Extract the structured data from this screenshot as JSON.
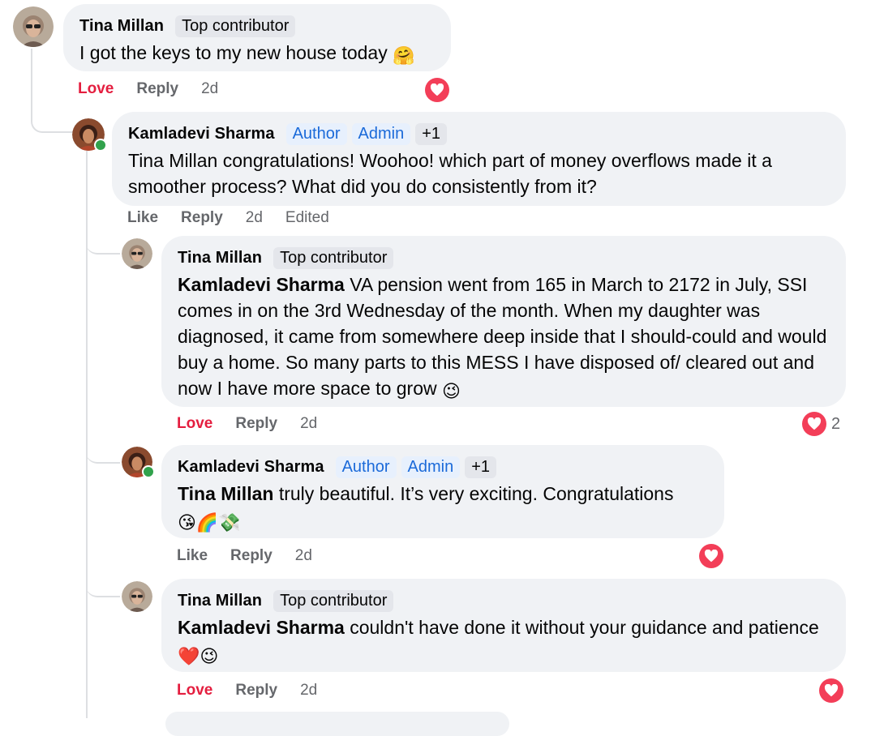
{
  "comments": [
    {
      "author": "Tina Millan",
      "badge": "Top contributor",
      "text": "I got the keys to my new house today",
      "emoji": "🤗",
      "love": "Love",
      "reply": "Reply",
      "time": "2d"
    },
    {
      "author": "Kamladevi Sharma",
      "badges": [
        "Author",
        "Admin",
        "+1"
      ],
      "text": "Tina Millan congratulations! Woohoo! which part of money overflows made it a smoother process? What did you do consistently from it?",
      "like": "Like",
      "reply": "Reply",
      "time": "2d",
      "edited": "Edited"
    },
    {
      "author": "Tina Millan",
      "badge": "Top contributor",
      "mention": "Kamladevi Sharma",
      "text": "VA pension went from 165 in March to 2172 in July, SSI comes in on the 3rd Wednesday of the month. When my daughter was diagnosed, it came from somewhere deep inside that I should-could and would buy a home. So many parts to this MESS I have disposed of/ cleared out and now I have more space to grow",
      "emoji": "😉",
      "love": "Love",
      "reply": "Reply",
      "time": "2d",
      "reaction_count": "2"
    },
    {
      "author": "Kamladevi Sharma",
      "badges": [
        "Author",
        "Admin",
        "+1"
      ],
      "mention": "Tina Millan",
      "text": "truly beautiful. It’s very exciting. Congratulations",
      "emojis": "😘🌈💸",
      "like": "Like",
      "reply": "Reply",
      "time": "2d"
    },
    {
      "author": "Tina Millan",
      "badge": "Top contributor",
      "mention": "Kamladevi Sharma",
      "text": "couldn't have done it without your guidance and patience",
      "emojis": "❤️😉",
      "love": "Love",
      "reply": "Reply",
      "time": "2d"
    }
  ],
  "icons": {
    "reaction": "heart-reaction-icon"
  },
  "colors": {
    "love": "#e41e3f",
    "badge_blue": "#1b6ad9",
    "bubble": "#f0f2f5",
    "online": "#31a24c"
  }
}
